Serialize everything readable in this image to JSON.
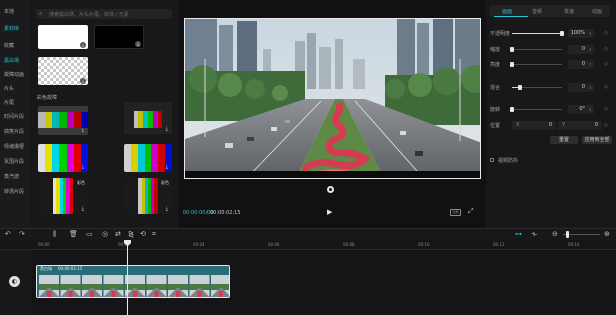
{
  "sidebar": {
    "items": [
      {
        "label": "本地",
        "active": false
      },
      {
        "label": "素材库",
        "active": true
      },
      {
        "label": "收藏",
        "active": false
      },
      {
        "label": "黑白场",
        "active": true
      },
      {
        "label": "故障动画",
        "active": false
      },
      {
        "label": "片头",
        "active": false
      },
      {
        "label": "片尾",
        "active": false
      },
      {
        "label": "时间片段",
        "active": false
      },
      {
        "label": "搞笑片段",
        "active": false
      },
      {
        "label": "情绪爆梗",
        "active": false
      },
      {
        "label": "氛围片段",
        "active": false
      },
      {
        "label": "蒸汽波",
        "active": false
      },
      {
        "label": "转场片段",
        "active": false
      },
      {
        "label": "空镜头",
        "active": false
      }
    ]
  },
  "library": {
    "search_placeholder": "搜索黑白场、片头片尾、转场 / 元素",
    "section_title": "彩色故障",
    "tile_tag": "彩色",
    "download_glyph": "⤓"
  },
  "player": {
    "time_current": "00:00:00:00",
    "time_separator": "/",
    "time_total": "00:00:02:15",
    "play_glyph": "▶",
    "ratio_label": "比例",
    "fullscreen_glyph": "⤢"
  },
  "inspector": {
    "tabs": [
      {
        "label": "画面",
        "active": true
      },
      {
        "label": "音频",
        "active": false
      },
      {
        "label": "变速",
        "active": false
      },
      {
        "label": "动画",
        "active": false
      }
    ],
    "properties": [
      {
        "label": "不透明度",
        "value": "100%",
        "fill": 1.0
      },
      {
        "label": "缩放",
        "value": "0",
        "fill": 0.0
      },
      {
        "label": "亮度",
        "value": "0",
        "fill": 0.0
      },
      {
        "label": "混合",
        "value": "0",
        "fill": 0.15
      },
      {
        "label": "旋转",
        "value": "0°",
        "fill": 0.0
      }
    ],
    "position": {
      "label": "位置",
      "x_axis": "X",
      "x_value": "0",
      "y_axis": "Y",
      "y_value": "0"
    },
    "reset_label": "重置",
    "apply_all_label": "应用到全部",
    "blend_label": "视频防抖"
  },
  "timeline": {
    "ruler_ticks": [
      "00:00",
      "00:02",
      "00:04",
      "00:06",
      "00:08",
      "00:10",
      "00:12",
      "00:14",
      "00:16"
    ],
    "clip": {
      "name": "黑白场",
      "duration": "00:00:02:15"
    },
    "track_icon": "◐"
  },
  "colors": {
    "accent": "#28c3d4",
    "clip_teal": "#2b6b76",
    "panel": "#18181a"
  },
  "toolbar": {
    "icons": [
      "undo-icon",
      "redo-icon",
      "split-icon",
      "delete-icon",
      "freeze-icon",
      "record-icon",
      "reverse-icon",
      "mirror-icon",
      "rotate-icon",
      "crop-icon"
    ]
  }
}
